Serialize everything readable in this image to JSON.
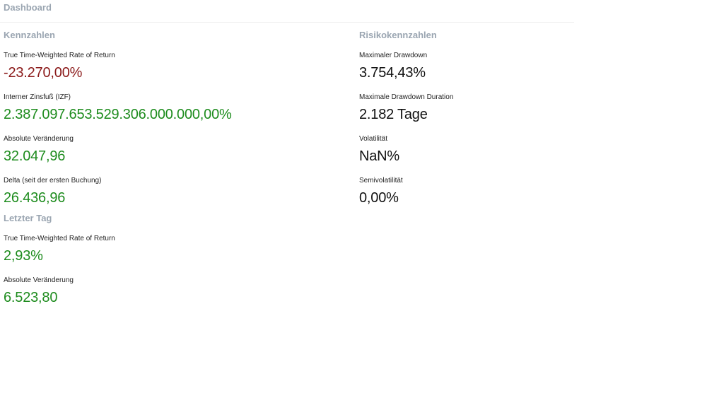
{
  "header": {
    "title": "Dashboard"
  },
  "colors": {
    "section_title": "#9aa5b1",
    "positive": "#1e8c1e",
    "negative": "#8b1a1a",
    "neutral": "#111111"
  },
  "kennzahlen": {
    "title": "Kennzahlen",
    "metrics": [
      {
        "label": "True Time-Weighted Rate of Return",
        "value": "-23.270,00%",
        "tone": "negative"
      },
      {
        "label": "Interner Zinsfuß (IZF)",
        "value": "2.387.097.653.529.306.000.000,00%",
        "tone": "positive"
      },
      {
        "label": "Absolute Veränderung",
        "value": "32.047,96",
        "tone": "positive"
      },
      {
        "label": "Delta (seit der ersten Buchung)",
        "value": "26.436,96",
        "tone": "positive"
      }
    ]
  },
  "letzter_tag": {
    "title": "Letzter Tag",
    "metrics": [
      {
        "label": "True Time-Weighted Rate of Return",
        "value": "2,93%",
        "tone": "positive"
      },
      {
        "label": "Absolute Veränderung",
        "value": "6.523,80",
        "tone": "positive"
      }
    ]
  },
  "risiko": {
    "title": "Risikokennzahlen",
    "metrics": [
      {
        "label": "Maximaler Drawdown",
        "value": "3.754,43%",
        "tone": "neutral"
      },
      {
        "label": "Maximale Drawdown Duration",
        "value": "2.182 Tage",
        "tone": "neutral"
      },
      {
        "label": "Volatilität",
        "value": "NaN%",
        "tone": "neutral"
      },
      {
        "label": "Semivolatilität",
        "value": "0,00%",
        "tone": "neutral"
      }
    ]
  }
}
